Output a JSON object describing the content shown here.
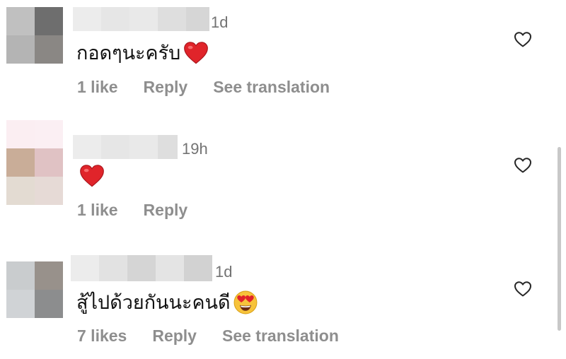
{
  "comments": [
    {
      "time": "1d",
      "text": "กอดๆนะครับ",
      "emoji": "red-heart",
      "likes": "1 like",
      "reply": "Reply",
      "translate": "See translation"
    },
    {
      "time": "19h",
      "text": "",
      "emoji": "red-heart",
      "likes": "1 like",
      "reply": "Reply",
      "translate": ""
    },
    {
      "time": "1d",
      "text": "สู้ไปด้วยกันนะคนดี",
      "emoji": "heart-eyes-face",
      "likes": "7 likes",
      "reply": "Reply",
      "translate": "See translation"
    }
  ],
  "colors": {
    "secondary_text": "#8e8e8e",
    "timestamp": "#737373",
    "heart_red": "#e0242a",
    "emoji_face": "#f7c33b"
  },
  "icons": {
    "like_button": "heart-outline-icon"
  }
}
